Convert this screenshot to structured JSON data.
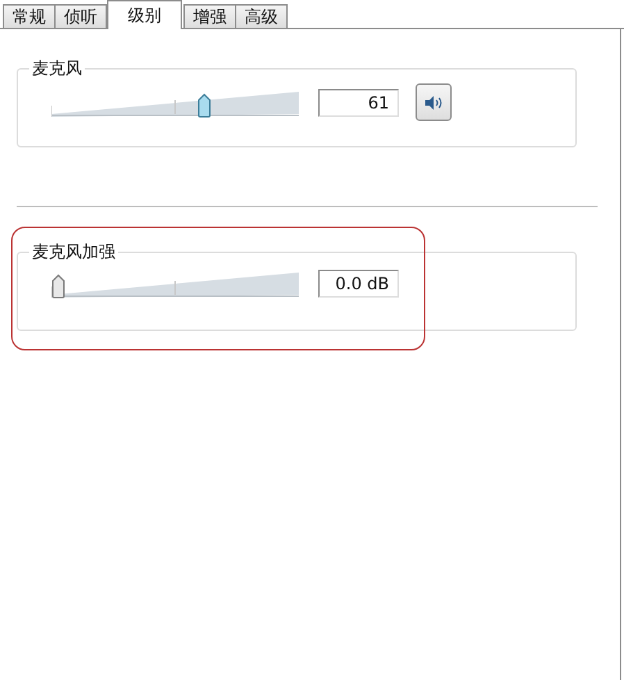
{
  "tabs": [
    {
      "label": "常规",
      "selected": false
    },
    {
      "label": "侦听",
      "selected": false
    },
    {
      "label": "级别",
      "selected": true
    },
    {
      "label": "增强",
      "selected": false
    },
    {
      "label": "高级",
      "selected": false
    }
  ],
  "groups": [
    {
      "title": "麦克风",
      "level": 0.61,
      "value": "61",
      "speaker_button": true,
      "highlighted": false
    },
    {
      "title": "麦克风加强",
      "level": 0,
      "value": "0.0 dB",
      "speaker_button": false,
      "highlighted": true
    }
  ]
}
